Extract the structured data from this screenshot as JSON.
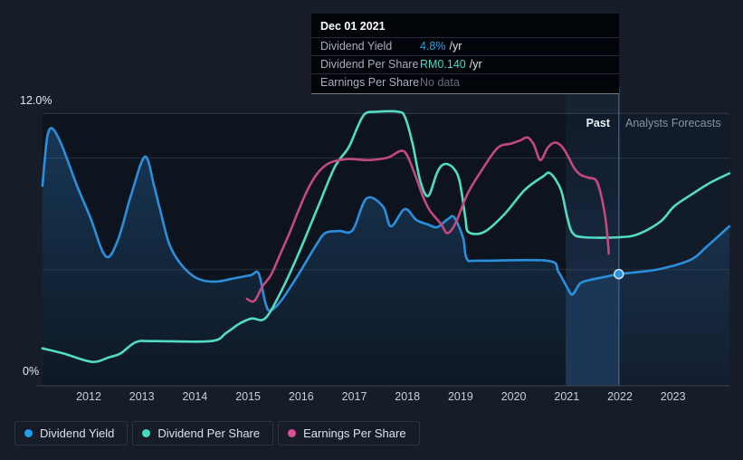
{
  "tooltip": {
    "date": "Dec 01 2021",
    "rows": [
      {
        "label": "Dividend Yield",
        "value": "4.8%",
        "suffix": "/yr",
        "value_color": "#2f9fe8"
      },
      {
        "label": "Dividend Per Share",
        "value": "RM0.140",
        "suffix": "/yr",
        "value_color": "#45dcc4"
      },
      {
        "label": "Earnings Per Share",
        "value": "No data",
        "suffix": "",
        "value_color": "#666e7a"
      }
    ]
  },
  "regions": {
    "past_label": "Past",
    "forecast_label": "Analysts Forecasts"
  },
  "axis": {
    "y_top_label": "12.0%",
    "y_bottom_label": "0%"
  },
  "legend": [
    {
      "label": "Dividend Yield",
      "color": "#219cf0"
    },
    {
      "label": "Dividend Per Share",
      "color": "#45dcc4"
    },
    {
      "label": "Earnings Per Share",
      "color": "#df4e98"
    }
  ],
  "colors": {
    "plot_past_bg": "#0d141e",
    "plot_forecast_bg": "#121b29",
    "grid": "#273040",
    "grid_top": "#323b48",
    "axis_line": "#3b4452",
    "divider": "#3e6693",
    "band_top": "rgba(70,135,220,0.04)",
    "band_bottom": "rgba(70,135,220,0.27)",
    "area_top": "rgba(47,134,210,0.32)",
    "area_bottom": "rgba(47,134,210,0.03)",
    "dot_ring": "rgba(225,242,250,0.85)"
  },
  "chart_data": {
    "type": "line",
    "x_ticks": [
      2012,
      2013,
      2014,
      2015,
      2016,
      2017,
      2018,
      2019,
      2020,
      2021,
      2022,
      2023
    ],
    "x_domain": [
      2011.13,
      2024.06
    ],
    "y_left_percent": {
      "domain": [
        0,
        12
      ],
      "gridlines": [
        12,
        10,
        5
      ],
      "top_label": "12.0%",
      "bottom_label": "0%"
    },
    "y_right_rm": {
      "domain": [
        0,
        0.2604
      ]
    },
    "forecast_start_x": 2021.98,
    "highlight_band_x": [
      2020.98,
      2021.98
    ],
    "marker": {
      "date": "Dec 01 2021",
      "dividend_yield_pct": 4.8,
      "dividend_per_share_rm": 0.14
    },
    "legend_position": "bottom",
    "series": [
      {
        "name": "Dividend Yield",
        "axis": "pct",
        "units": "%",
        "color": "#2b8fdc",
        "area_fill": true,
        "points": [
          [
            2011.13,
            8.76
          ],
          [
            2011.18,
            10.1
          ],
          [
            2011.23,
            11.07
          ],
          [
            2011.32,
            11.32
          ],
          [
            2011.49,
            10.59
          ],
          [
            2011.78,
            8.76
          ],
          [
            2012.03,
            7.34
          ],
          [
            2012.32,
            5.6
          ],
          [
            2012.55,
            6.33
          ],
          [
            2012.8,
            8.36
          ],
          [
            2013.06,
            10.06
          ],
          [
            2013.23,
            8.76
          ],
          [
            2013.35,
            7.63
          ],
          [
            2013.52,
            6.13
          ],
          [
            2013.74,
            5.23
          ],
          [
            2014.03,
            4.62
          ],
          [
            2014.37,
            4.46
          ],
          [
            2014.76,
            4.62
          ],
          [
            2015.05,
            4.75
          ],
          [
            2015.2,
            4.83
          ],
          [
            2015.32,
            3.57
          ],
          [
            2015.41,
            3.16
          ],
          [
            2015.61,
            3.57
          ],
          [
            2015.95,
            4.79
          ],
          [
            2016.29,
            6.13
          ],
          [
            2016.46,
            6.65
          ],
          [
            2016.72,
            6.73
          ],
          [
            2016.97,
            6.77
          ],
          [
            2017.23,
            8.19
          ],
          [
            2017.54,
            7.83
          ],
          [
            2017.69,
            6.94
          ],
          [
            2017.95,
            7.71
          ],
          [
            2018.17,
            7.22
          ],
          [
            2018.39,
            7.02
          ],
          [
            2018.56,
            6.9
          ],
          [
            2018.76,
            7.26
          ],
          [
            2018.88,
            7.34
          ],
          [
            2019.05,
            6.41
          ],
          [
            2019.12,
            5.48
          ],
          [
            2019.36,
            5.4
          ],
          [
            2020.64,
            5.4
          ],
          [
            2020.84,
            4.91
          ],
          [
            2021.01,
            4.18
          ],
          [
            2021.11,
            3.89
          ],
          [
            2021.25,
            4.38
          ],
          [
            2021.44,
            4.54
          ],
          [
            2021.71,
            4.67
          ],
          [
            2021.98,
            4.8
          ],
          [
            2022.25,
            4.87
          ],
          [
            2022.76,
            5.03
          ],
          [
            2023.33,
            5.44
          ],
          [
            2023.62,
            6.0
          ],
          [
            2024.06,
            6.94
          ]
        ]
      },
      {
        "name": "Dividend Per Share",
        "axis": "rm",
        "units": "RM",
        "color": "#52dcc4",
        "area_fill": false,
        "points": [
          [
            2011.13,
            0.032
          ],
          [
            2011.52,
            0.027
          ],
          [
            2011.95,
            0.02
          ],
          [
            2012.15,
            0.019
          ],
          [
            2012.37,
            0.023
          ],
          [
            2012.6,
            0.027
          ],
          [
            2012.89,
            0.038
          ],
          [
            2013.23,
            0.039
          ],
          [
            2014.3,
            0.039
          ],
          [
            2014.59,
            0.047
          ],
          [
            2014.84,
            0.056
          ],
          [
            2015.07,
            0.061
          ],
          [
            2015.32,
            0.061
          ],
          [
            2015.61,
            0.086
          ],
          [
            2015.95,
            0.124
          ],
          [
            2016.29,
            0.166
          ],
          [
            2016.63,
            0.208
          ],
          [
            2016.89,
            0.227
          ],
          [
            2017.06,
            0.247
          ],
          [
            2017.2,
            0.26
          ],
          [
            2017.4,
            0.262
          ],
          [
            2017.83,
            0.262
          ],
          [
            2017.96,
            0.256
          ],
          [
            2018.1,
            0.23
          ],
          [
            2018.24,
            0.195
          ],
          [
            2018.39,
            0.18
          ],
          [
            2018.56,
            0.203
          ],
          [
            2018.69,
            0.211
          ],
          [
            2018.85,
            0.208
          ],
          [
            2018.98,
            0.195
          ],
          [
            2019.09,
            0.159
          ],
          [
            2019.15,
            0.145
          ],
          [
            2019.44,
            0.145
          ],
          [
            2019.82,
            0.162
          ],
          [
            2020.21,
            0.186
          ],
          [
            2020.55,
            0.199
          ],
          [
            2020.69,
            0.202
          ],
          [
            2020.89,
            0.186
          ],
          [
            2021.01,
            0.159
          ],
          [
            2021.11,
            0.144
          ],
          [
            2021.32,
            0.14
          ],
          [
            2021.98,
            0.14
          ],
          [
            2022.34,
            0.143
          ],
          [
            2022.76,
            0.155
          ],
          [
            2023.02,
            0.17
          ],
          [
            2023.33,
            0.181
          ],
          [
            2023.7,
            0.193
          ],
          [
            2024.06,
            0.202
          ]
        ]
      },
      {
        "name": "Earnings Per Share",
        "axis": "rm",
        "units": "RM",
        "color": "#c4497f",
        "area_fill": false,
        "points": [
          [
            2014.98,
            0.08
          ],
          [
            2015.12,
            0.078
          ],
          [
            2015.27,
            0.092
          ],
          [
            2015.44,
            0.104
          ],
          [
            2015.61,
            0.124
          ],
          [
            2015.78,
            0.144
          ],
          [
            2015.95,
            0.166
          ],
          [
            2016.12,
            0.186
          ],
          [
            2016.29,
            0.201
          ],
          [
            2016.46,
            0.21
          ],
          [
            2016.63,
            0.214
          ],
          [
            2016.89,
            0.216
          ],
          [
            2017.23,
            0.215
          ],
          [
            2017.49,
            0.216
          ],
          [
            2017.66,
            0.218
          ],
          [
            2017.88,
            0.224
          ],
          [
            2018.0,
            0.219
          ],
          [
            2018.17,
            0.197
          ],
          [
            2018.29,
            0.18
          ],
          [
            2018.42,
            0.166
          ],
          [
            2018.63,
            0.153
          ],
          [
            2018.75,
            0.144
          ],
          [
            2018.9,
            0.153
          ],
          [
            2019.14,
            0.183
          ],
          [
            2019.41,
            0.206
          ],
          [
            2019.7,
            0.227
          ],
          [
            2019.95,
            0.231
          ],
          [
            2020.12,
            0.234
          ],
          [
            2020.26,
            0.237
          ],
          [
            2020.38,
            0.23
          ],
          [
            2020.5,
            0.215
          ],
          [
            2020.64,
            0.227
          ],
          [
            2020.77,
            0.232
          ],
          [
            2020.91,
            0.228
          ],
          [
            2021.03,
            0.218
          ],
          [
            2021.13,
            0.208
          ],
          [
            2021.25,
            0.201
          ],
          [
            2021.4,
            0.198
          ],
          [
            2021.54,
            0.196
          ],
          [
            2021.62,
            0.186
          ],
          [
            2021.71,
            0.164
          ],
          [
            2021.76,
            0.144
          ],
          [
            2021.79,
            0.124
          ]
        ]
      }
    ]
  }
}
